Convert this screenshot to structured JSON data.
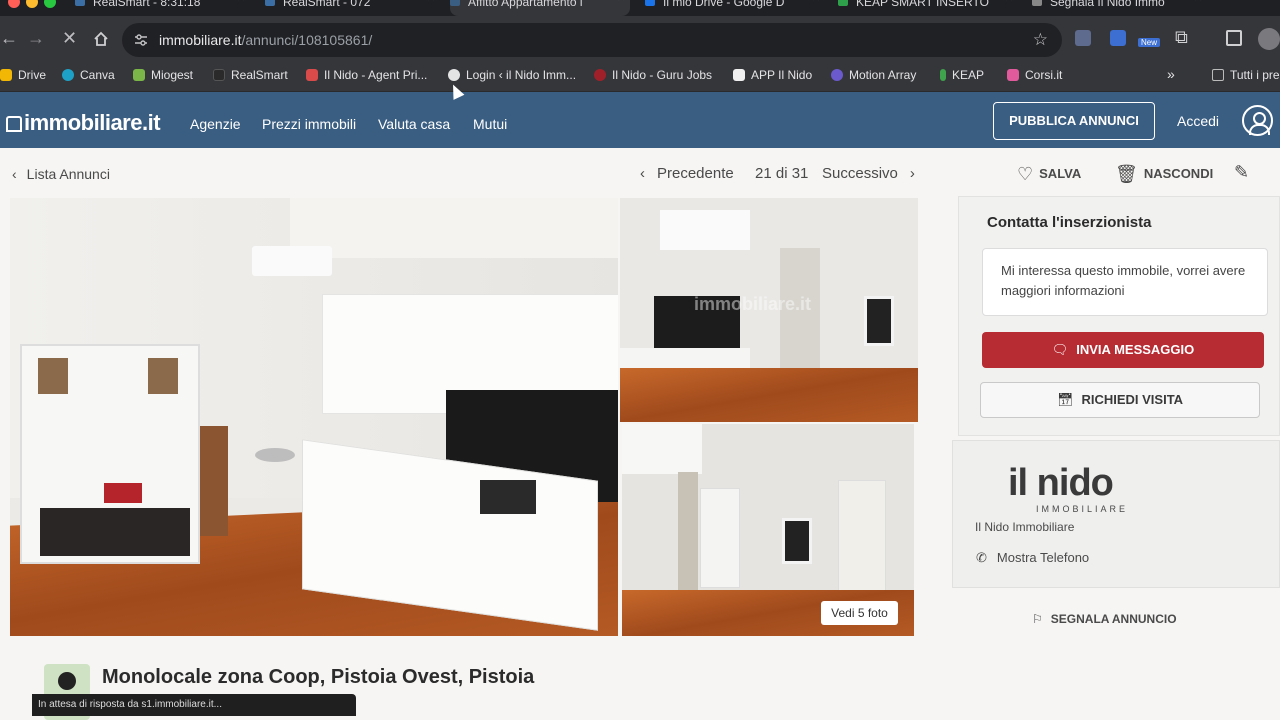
{
  "browser": {
    "tabs": [
      {
        "title": "RealSmart - 8:31:18",
        "fav_color": "#3b6ea5"
      },
      {
        "title": "RealSmart - 072",
        "fav_color": "#3b6ea5"
      },
      {
        "title": "Affitto Appartamento i",
        "fav_color": "#3a5d82"
      },
      {
        "title": "Il mio Drive - Google D",
        "fav_color": "#1a73e8"
      },
      {
        "title": "KEAP SMART INSERTO",
        "fav_color": "#2e9f4a"
      },
      {
        "title": "Segnala Il Nido Immo",
        "fav_color": "#888888"
      }
    ],
    "url_domain": "immobiliare.it",
    "url_path": "/annunci/108105861/",
    "bookmarks": [
      {
        "label": "Drive",
        "color": "#f2b705"
      },
      {
        "label": "Canva",
        "color": "#1ea1c7"
      },
      {
        "label": "Miogest",
        "color": "#7ab648"
      },
      {
        "label": "RealSmart",
        "color": "#2a2a2a"
      },
      {
        "label": "Il Nido - Agent Pri...",
        "color": "#d94a4a"
      },
      {
        "label": "Login ‹ il Nido Imm...",
        "color": "#e4e4e4"
      },
      {
        "label": "Il Nido - Guru Jobs",
        "color": "#a0202a"
      },
      {
        "label": "APP Il Nido",
        "color": "#f0f0f0"
      },
      {
        "label": "Motion Array",
        "color": "#6a5acd"
      },
      {
        "label": "KEAP",
        "color": "#3fa34d"
      },
      {
        "label": "Corsi.it",
        "color": "#e05a9c"
      },
      {
        "label": "Tutti i pre",
        "color": "#bbbbbb"
      }
    ],
    "new_badge": "New",
    "status_text": "In attesa di risposta da s1.immobiliare.it..."
  },
  "header": {
    "logo": "immobiliare.it",
    "nav": [
      "Agenzie",
      "Prezzi immobili",
      "Valuta casa",
      "Mutui"
    ],
    "publish_button": "PUBBLICA ANNUNCI",
    "login": "Accedi"
  },
  "subbar": {
    "back": "Lista Annunci",
    "prev": "Precedente",
    "counter": "21 di 31",
    "next": "Successivo",
    "save": "SALVA",
    "hide": "NASCONDI"
  },
  "gallery": {
    "watermark": "immobiliare.it",
    "more_photos": "Vedi 5 foto"
  },
  "contact": {
    "title": "Contatta l'inserzionista",
    "message": "Mi interessa questo immobile, vorrei avere maggiori informazioni",
    "send_button": "INVIA MESSAGGIO",
    "visit_button": "RICHIEDI VISITA"
  },
  "agency": {
    "logo": "il nido",
    "logo_sub": "IMMOBILIARE",
    "name": "Il Nido Immobiliare",
    "phone_link": "Mostra Telefono"
  },
  "report": "SEGNALA ANNUNCIO",
  "listing": {
    "title": "Monolocale zona Coop, Pistoia Ovest, Pistoia"
  },
  "colors": {
    "header_bg": "#3a5d82",
    "send_button": "#b72b32"
  }
}
